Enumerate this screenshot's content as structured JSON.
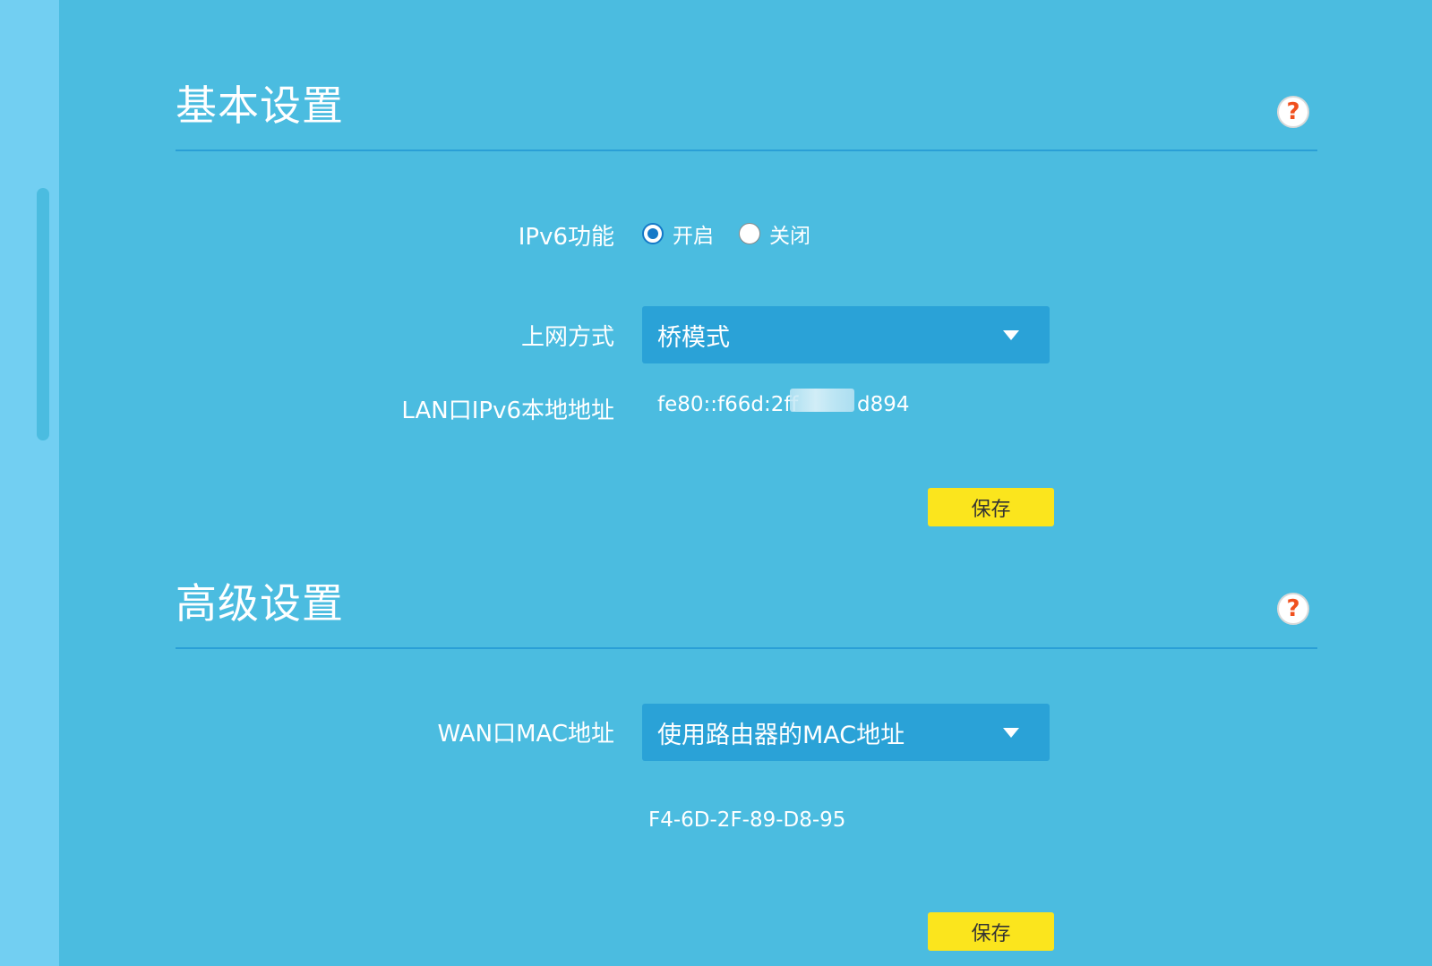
{
  "basic": {
    "title": "基本设置",
    "help_glyph": "?",
    "ipv6_label": "IPv6功能",
    "ipv6_on": "开启",
    "ipv6_off": "关闭",
    "ipv6_selected": "开启",
    "conn_label": "上网方式",
    "conn_value": "桥模式",
    "lan_label": "LAN口IPv6本地地址",
    "lan_value_start": "fe80::f66d:2ff",
    "lan_value_end": "d894",
    "save_label": "保存"
  },
  "advanced": {
    "title": "高级设置",
    "help_glyph": "?",
    "wan_mac_label": "WAN口MAC地址",
    "wan_mac_select": "使用路由器的MAC地址",
    "mac_value": "F4-6D-2F-89-D8-95",
    "save_label": "保存"
  },
  "colors": {
    "background": "#4bbce0",
    "sidebar": "#72cff2",
    "select_bg": "#2aa2d7",
    "save_button": "#fbe51d",
    "help_icon": "#f0501e",
    "radio_checked": "#1479c8"
  },
  "icons": {
    "help": "question-mark-circle-icon",
    "dropdown": "triangle-down-icon"
  }
}
